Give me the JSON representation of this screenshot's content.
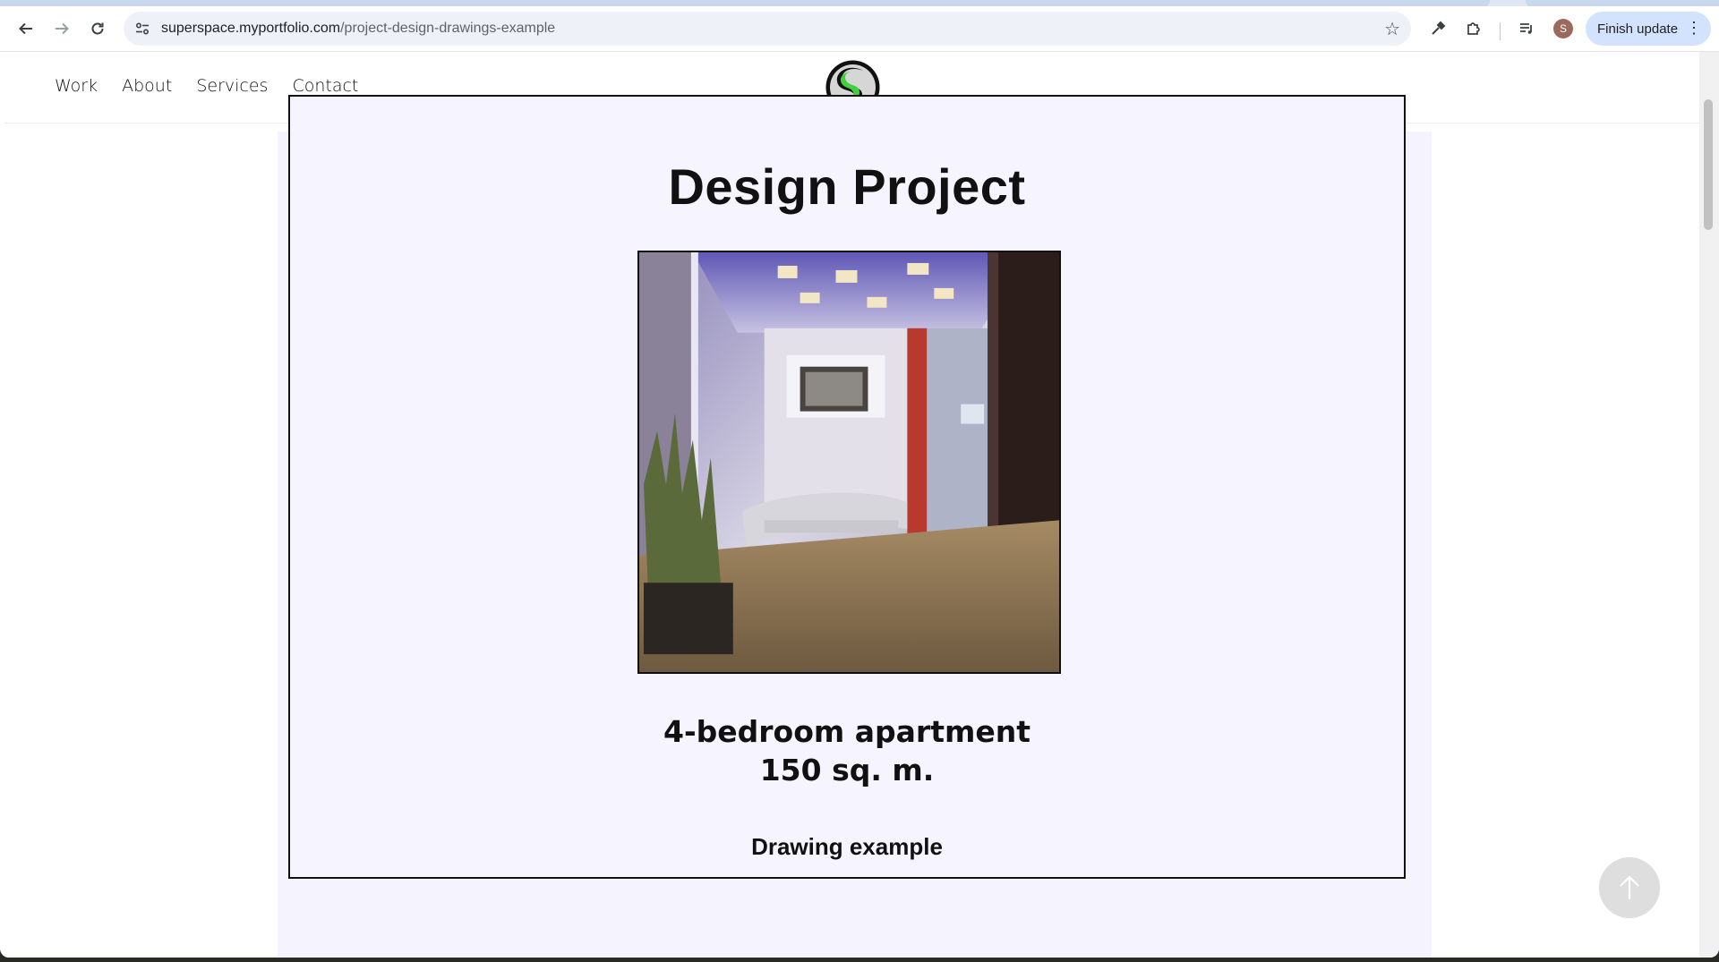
{
  "browser": {
    "url_host": "superspace.myportfolio.com",
    "url_path": "/project-design-drawings-example",
    "profile_initial": "S",
    "finish_update_label": "Finish update"
  },
  "nav": {
    "items": [
      "Work",
      "About",
      "Services",
      "Contact"
    ]
  },
  "project": {
    "title": "Design Project",
    "subtitle_line1": "4-bedroom apartment",
    "subtitle_line2": "150 sq. m.",
    "section_heading": "Drawing example"
  },
  "colors": {
    "logo_green": "#3fd13a",
    "content_background": "#f5f4fe",
    "accent_red": "#c0392b"
  },
  "icons": {
    "back": "arrow-left-icon",
    "forward": "arrow-right-icon",
    "reload": "reload-icon",
    "site_info": "tune-icon",
    "bookmark": "star-icon",
    "to_top": "arrow-up-icon"
  }
}
